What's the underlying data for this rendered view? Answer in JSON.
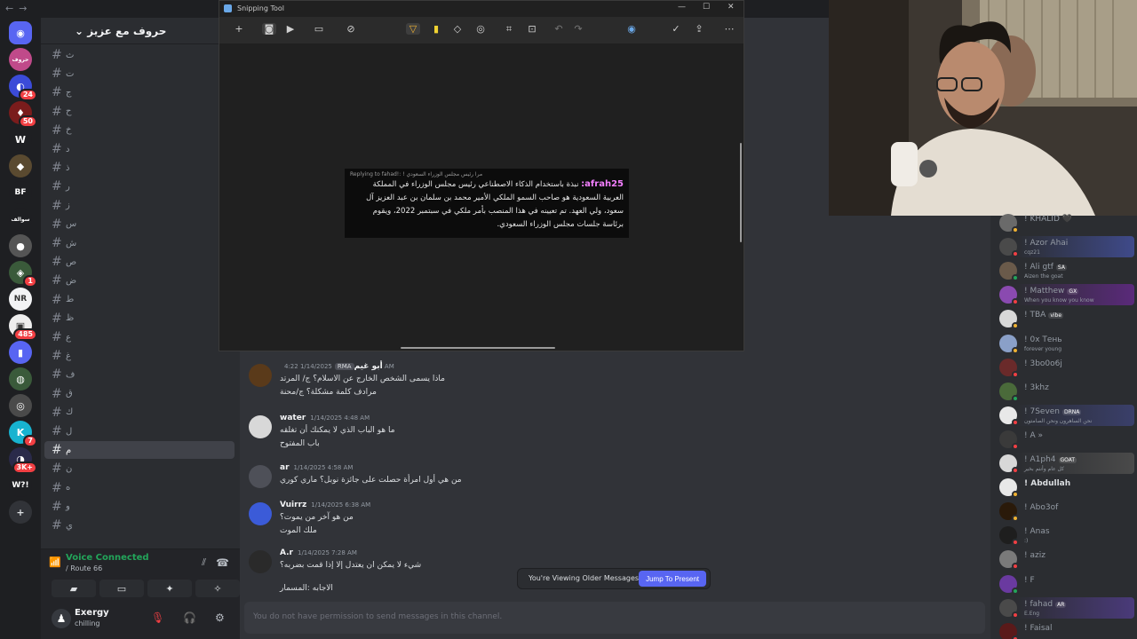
{
  "topbar": {
    "nav": "←→"
  },
  "rail": {
    "servers": [
      {
        "icon": "discord-icon",
        "glyph": "◉",
        "color": "#5865f2",
        "badge": ""
      },
      {
        "icon": "server-icon",
        "glyph": "حروف",
        "color": "#c04a8a",
        "badge": ""
      },
      {
        "icon": "server-icon",
        "glyph": "◐",
        "color": "#3b4bd8",
        "badge": "24"
      },
      {
        "icon": "server-icon",
        "glyph": "♦",
        "color": "#7a1c1c",
        "badge": "50"
      },
      {
        "icon": "server-icon",
        "glyph": "W",
        "color": "#1e1f22",
        "badge": ""
      },
      {
        "icon": "server-icon",
        "glyph": "◆",
        "color": "#5a4a30",
        "badge": ""
      },
      {
        "icon": "server-icon",
        "glyph": "BF",
        "color": "#1e1f22",
        "badge": ""
      },
      {
        "icon": "server-icon",
        "glyph": "سوالف",
        "color": "#1e1f22",
        "badge": ""
      },
      {
        "icon": "server-icon",
        "glyph": "●",
        "color": "#555",
        "badge": ""
      },
      {
        "icon": "server-icon",
        "glyph": "◈",
        "color": "#3a5a3a",
        "badge": "1"
      },
      {
        "icon": "server-icon",
        "glyph": "NR",
        "color": "#f2f3f5",
        "badge": ""
      },
      {
        "icon": "server-icon",
        "glyph": "▣",
        "color": "#eee",
        "badge": "485"
      },
      {
        "icon": "folder-icon",
        "glyph": "▮",
        "color": "#5865f2",
        "badge": ""
      },
      {
        "icon": "server-icon",
        "glyph": "◍",
        "color": "#3a5a3a",
        "badge": ""
      },
      {
        "icon": "server-icon",
        "glyph": "◎",
        "color": "#4a4a4a",
        "badge": ""
      },
      {
        "icon": "server-icon",
        "glyph": "K",
        "color": "#17b3d0",
        "badge": "7"
      },
      {
        "icon": "server-icon",
        "glyph": "◑",
        "color": "#2a2a4a",
        "badge": "3K+"
      },
      {
        "icon": "server-icon",
        "glyph": "W?!",
        "color": "#1e1f22",
        "badge": ""
      },
      {
        "icon": "add-server-icon",
        "glyph": "+",
        "color": "#313338",
        "badge": ""
      }
    ]
  },
  "sidebar": {
    "guild_name": "حروف مع عزيز",
    "channels": [
      "ث",
      "ت",
      "ج",
      "ح",
      "خ",
      "د",
      "ذ",
      "ر",
      "ز",
      "س",
      "ش",
      "ص",
      "ض",
      "ط",
      "ظ",
      "ع",
      "غ",
      "ف",
      "ق",
      "ك",
      "ل",
      "م",
      "ن",
      "ه",
      "و",
      "ي"
    ],
    "active_channel": "م"
  },
  "voice": {
    "title": "Voice Connected",
    "sub": "/ Route 66"
  },
  "user": {
    "name": "Exergy",
    "status": "chilling"
  },
  "snip": {
    "title": "Snipping Tool",
    "reply_line": "Replying to fahad!: ! مرا رئيس مجلس الوزراء السعودي",
    "author": "afrah25:",
    "body": "نبذة باستخدام الذكاء الاصطناعي رئيس مجلس الوزراء في المملكة العربية السعودية هو صاحب السمو الملكي الأمير محمد بن سلمان بن عبد العزيز آل سعود، ولي العهد. تم تعيينه في هذا المنصب بأمر ملكي في سبتمبر 2022، ويقوم برئاسة جلسات مجلس الوزراء السعودي."
  },
  "messages": [
    {
      "author": "أبو غيم",
      "tag": "RMA",
      "time": "1/14/2025 4:22 AM",
      "avatar_color": "#5a3a1a",
      "lines": [
        "ماذا يسمى الشخص الخارج عن الاسلام؟ ج/ المرتد",
        "مرادف كلمة مشكلة؟ ج/محنة"
      ]
    },
    {
      "author": "water",
      "tag": "",
      "time": "1/14/2025 4:48 AM",
      "avatar_color": "#d8d8d8",
      "lines": [
        "ما هو الباب الذي لا يمكنك أن تغلقه",
        "باب المفتوح"
      ]
    },
    {
      "author": "ar",
      "tag": "",
      "time": "1/14/2025 4:58 AM",
      "avatar_color": "#4e5058",
      "lines": [
        "من هي أول امرأة حصلت على جائزة نوبل؟ ماري كوري"
      ]
    },
    {
      "author": "Vuirrz",
      "tag": "",
      "time": "1/14/2025 6:38 AM",
      "avatar_color": "#3b5bd8",
      "lines": [
        "من هو آخر من يموت؟",
        "ملك الموت"
      ]
    },
    {
      "author": "A.r",
      "tag": "",
      "time": "1/14/2025 7:28 AM",
      "avatar_color": "#2a2a2a",
      "lines": [
        "شيء لا يمكن ان يعتدل إلا إذا قمت بضربه؟",
        "الاجابه :المسمار"
      ]
    }
  ],
  "banner": {
    "text": "You're Viewing Older Messages",
    "button": "Jump To Present"
  },
  "composer": {
    "placeholder": "You do not have permission to send messages in this channel."
  },
  "members": [
    {
      "name": "! KHALID 🖤",
      "sub": "",
      "tag": "",
      "color": "#6a6a6a",
      "status": "#f0b232",
      "highlight": "",
      "bold": false
    },
    {
      "name": "! Azor Ahai",
      "sub": "cqz21",
      "tag": "",
      "color": "#4a4a4a",
      "status": "#f23f43",
      "highlight": "#3f4a8a",
      "bold": false
    },
    {
      "name": "! Ali gtf",
      "sub": "Aizen the goat",
      "tag": "SA",
      "color": "#6a5a4a",
      "status": "#23a55a",
      "highlight": "",
      "bold": false
    },
    {
      "name": "! Matthew",
      "sub": "When you know you know",
      "tag": "GX",
      "color": "#8a4ab0",
      "status": "#f23f43",
      "highlight": "#5a2a7a",
      "bold": false
    },
    {
      "name": "! TBA",
      "sub": "",
      "tag": "vibe",
      "color": "#d8d8d8",
      "status": "#f0b232",
      "highlight": "",
      "bold": false
    },
    {
      "name": "! 0x Тень",
      "sub": "forever young",
      "tag": "",
      "color": "#8aa0c8",
      "status": "#f0b232",
      "highlight": "",
      "bold": false
    },
    {
      "name": "! 3bo0o6j",
      "sub": "",
      "tag": "",
      "color": "#6a2a2a",
      "status": "#f23f43",
      "highlight": "",
      "bold": false
    },
    {
      "name": "! 3khz",
      "sub": "",
      "tag": "",
      "color": "#4a6a3a",
      "status": "#23a55a",
      "highlight": "",
      "bold": false
    },
    {
      "name": "! 7Seven",
      "sub": "نحن الساهرون ونحن الصامتون",
      "tag": "DRNA",
      "color": "#e8e8e8",
      "status": "#f23f43",
      "highlight": "#3a3f6a",
      "bold": false
    },
    {
      "name": "! A »",
      "sub": "",
      "tag": "",
      "color": "#3a3a3a",
      "status": "#f23f43",
      "highlight": "",
      "bold": false
    },
    {
      "name": "! A1ph4",
      "sub": "كل عام وأنتم بخير",
      "tag": "GOAT",
      "color": "#d8d8d8",
      "status": "#f23f43",
      "highlight": "#4a4a4a",
      "bold": false
    },
    {
      "name": "! Abdullah",
      "sub": "",
      "tag": "",
      "color": "#e8e8e8",
      "status": "#f0b232",
      "highlight": "",
      "bold": true
    },
    {
      "name": "! Abo3of",
      "sub": "",
      "tag": "",
      "color": "#2a1a0a",
      "status": "#f0b232",
      "highlight": "",
      "bold": false
    },
    {
      "name": "! Anas",
      "sub": ":)",
      "tag": "",
      "color": "#1e1e1e",
      "status": "#f23f43",
      "highlight": "",
      "bold": false
    },
    {
      "name": "! aziz",
      "sub": "",
      "tag": "",
      "color": "#7a7a7a",
      "status": "#f23f43",
      "highlight": "",
      "bold": false
    },
    {
      "name": "! F",
      "sub": "",
      "tag": "",
      "color": "#6a3aa0",
      "status": "#23a55a",
      "highlight": "",
      "bold": false
    },
    {
      "name": "! fahad",
      "sub": "E.Eng",
      "tag": "AR",
      "color": "#4a4a4a",
      "status": "#f23f43",
      "highlight": "#4a3a7a",
      "bold": false
    },
    {
      "name": "! Faisal",
      "sub": "",
      "tag": "",
      "color": "#5a1a1a",
      "status": "#f23f43",
      "highlight": "",
      "bold": false
    }
  ]
}
